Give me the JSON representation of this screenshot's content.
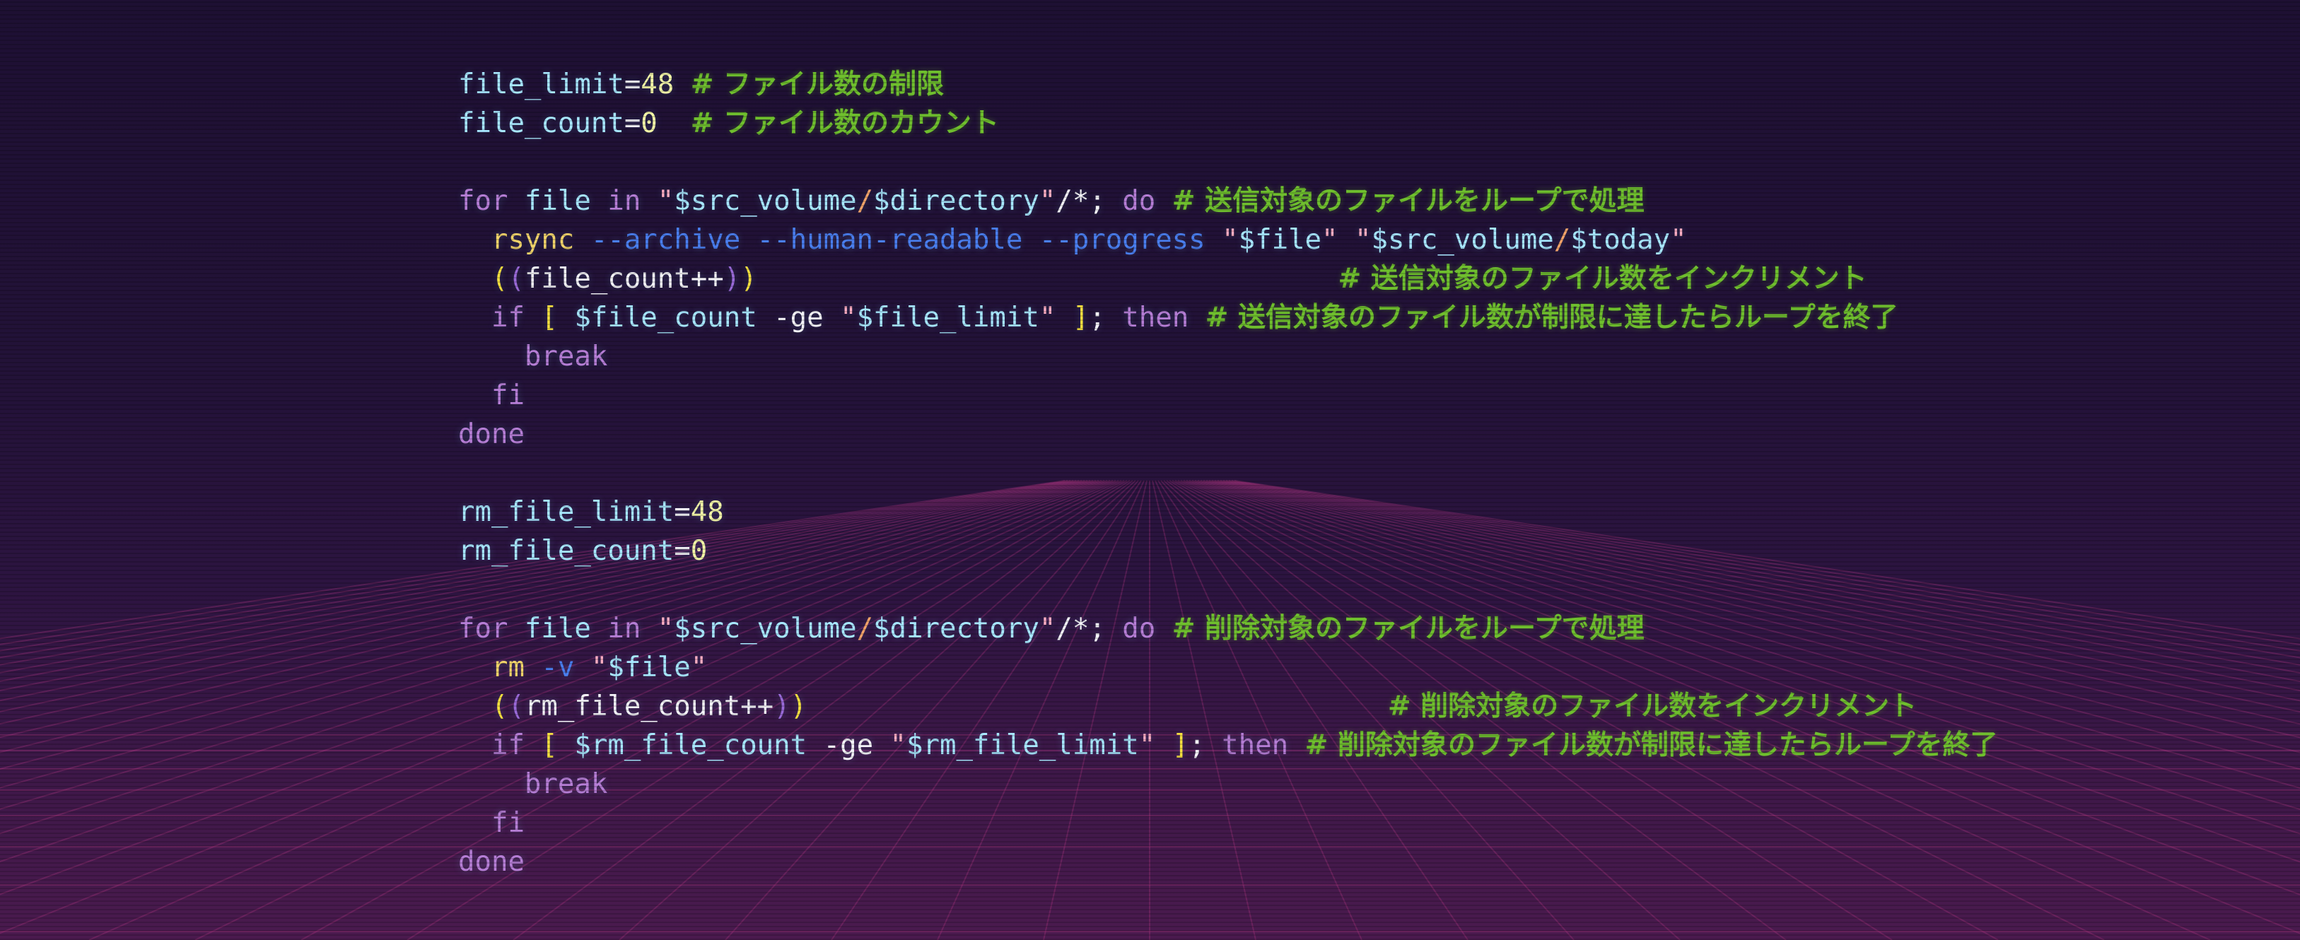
{
  "colors": {
    "variable": "#a8e8ff",
    "operator": "#f4f4f8",
    "number": "#f4f8a8",
    "comment": "#6fbf2e",
    "keyword": "#b67ed6",
    "string_quote": "#ffb0c4",
    "path_separator": "#f3a46a",
    "command": "#f1d46a",
    "flag": "#4a7ff0",
    "paren_outer": "#f5e040",
    "paren_inner": "#9a6ad8",
    "background_top": "#1e1033",
    "background_bottom": "#4a1a4e",
    "grid_line": "#c03a8a"
  },
  "code": {
    "lines": [
      [
        {
          "t": "file_limit",
          "c": "var"
        },
        {
          "t": "=",
          "c": "op"
        },
        {
          "t": "48",
          "c": "num"
        },
        {
          "t": " ",
          "c": "plain"
        },
        {
          "t": "# ファイル数の制限",
          "c": "com"
        }
      ],
      [
        {
          "t": "file_count",
          "c": "var"
        },
        {
          "t": "=",
          "c": "op"
        },
        {
          "t": "0",
          "c": "num"
        },
        {
          "t": "  ",
          "c": "plain"
        },
        {
          "t": "# ファイル数のカウント",
          "c": "com"
        }
      ],
      [],
      [
        {
          "t": "for",
          "c": "kw"
        },
        {
          "t": " file ",
          "c": "var"
        },
        {
          "t": "in",
          "c": "kw"
        },
        {
          "t": " ",
          "c": "plain"
        },
        {
          "t": "\"",
          "c": "str"
        },
        {
          "t": "$src_volume",
          "c": "var"
        },
        {
          "t": "/",
          "c": "sep"
        },
        {
          "t": "$directory",
          "c": "var"
        },
        {
          "t": "\"",
          "c": "str"
        },
        {
          "t": "/*; ",
          "c": "plain"
        },
        {
          "t": "do",
          "c": "kw"
        },
        {
          "t": " ",
          "c": "plain"
        },
        {
          "t": "# 送信対象のファイルをループで処理",
          "c": "com"
        }
      ],
      [
        {
          "t": "  ",
          "c": "plain"
        },
        {
          "t": "rsync",
          "c": "cmd"
        },
        {
          "t": " ",
          "c": "plain"
        },
        {
          "t": "--archive",
          "c": "flag"
        },
        {
          "t": " ",
          "c": "plain"
        },
        {
          "t": "--human-readable",
          "c": "flag"
        },
        {
          "t": " ",
          "c": "plain"
        },
        {
          "t": "--progress",
          "c": "flag"
        },
        {
          "t": " ",
          "c": "plain"
        },
        {
          "t": "\"",
          "c": "str"
        },
        {
          "t": "$file",
          "c": "var"
        },
        {
          "t": "\"",
          "c": "str"
        },
        {
          "t": " ",
          "c": "plain"
        },
        {
          "t": "\"",
          "c": "str"
        },
        {
          "t": "$src_volume",
          "c": "var"
        },
        {
          "t": "/",
          "c": "sep"
        },
        {
          "t": "$today",
          "c": "var"
        },
        {
          "t": "\"",
          "c": "str"
        }
      ],
      [
        {
          "t": "  ",
          "c": "plain"
        },
        {
          "t": "(",
          "c": "paren"
        },
        {
          "t": "(",
          "c": "paren2"
        },
        {
          "t": "file_count++",
          "c": "plain"
        },
        {
          "t": ")",
          "c": "paren2"
        },
        {
          "t": ")",
          "c": "paren"
        },
        {
          "t": "                                   ",
          "c": "plain"
        },
        {
          "t": "# 送信対象のファイル数をインクリメント",
          "c": "com"
        }
      ],
      [
        {
          "t": "  ",
          "c": "plain"
        },
        {
          "t": "if",
          "c": "kw"
        },
        {
          "t": " ",
          "c": "plain"
        },
        {
          "t": "[",
          "c": "paren"
        },
        {
          "t": " ",
          "c": "plain"
        },
        {
          "t": "$file_count",
          "c": "var"
        },
        {
          "t": " -ge ",
          "c": "plain"
        },
        {
          "t": "\"",
          "c": "str"
        },
        {
          "t": "$file_limit",
          "c": "var"
        },
        {
          "t": "\"",
          "c": "str"
        },
        {
          "t": " ",
          "c": "plain"
        },
        {
          "t": "]",
          "c": "paren"
        },
        {
          "t": "; ",
          "c": "plain"
        },
        {
          "t": "then",
          "c": "kw"
        },
        {
          "t": " ",
          "c": "plain"
        },
        {
          "t": "# 送信対象のファイル数が制限に達したらループを終了",
          "c": "com"
        }
      ],
      [
        {
          "t": "    ",
          "c": "plain"
        },
        {
          "t": "break",
          "c": "kw"
        }
      ],
      [
        {
          "t": "  ",
          "c": "plain"
        },
        {
          "t": "fi",
          "c": "kw"
        }
      ],
      [
        {
          "t": "done",
          "c": "kw"
        }
      ],
      [],
      [
        {
          "t": "rm_file_limit",
          "c": "var"
        },
        {
          "t": "=",
          "c": "op"
        },
        {
          "t": "48",
          "c": "num"
        }
      ],
      [
        {
          "t": "rm_file_count",
          "c": "var"
        },
        {
          "t": "=",
          "c": "op"
        },
        {
          "t": "0",
          "c": "num"
        }
      ],
      [],
      [
        {
          "t": "for",
          "c": "kw"
        },
        {
          "t": " file ",
          "c": "var"
        },
        {
          "t": "in",
          "c": "kw"
        },
        {
          "t": " ",
          "c": "plain"
        },
        {
          "t": "\"",
          "c": "str"
        },
        {
          "t": "$src_volume",
          "c": "var"
        },
        {
          "t": "/",
          "c": "sep"
        },
        {
          "t": "$directory",
          "c": "var"
        },
        {
          "t": "\"",
          "c": "str"
        },
        {
          "t": "/*; ",
          "c": "plain"
        },
        {
          "t": "do",
          "c": "kw"
        },
        {
          "t": " ",
          "c": "plain"
        },
        {
          "t": "# 削除対象のファイルをループで処理",
          "c": "com"
        }
      ],
      [
        {
          "t": "  ",
          "c": "plain"
        },
        {
          "t": "rm",
          "c": "cmd"
        },
        {
          "t": " ",
          "c": "plain"
        },
        {
          "t": "-v",
          "c": "flag"
        },
        {
          "t": " ",
          "c": "plain"
        },
        {
          "t": "\"",
          "c": "str"
        },
        {
          "t": "$file",
          "c": "var"
        },
        {
          "t": "\"",
          "c": "str"
        }
      ],
      [
        {
          "t": "  ",
          "c": "plain"
        },
        {
          "t": "(",
          "c": "paren"
        },
        {
          "t": "(",
          "c": "paren2"
        },
        {
          "t": "rm_file_count++",
          "c": "plain"
        },
        {
          "t": ")",
          "c": "paren2"
        },
        {
          "t": ")",
          "c": "paren"
        },
        {
          "t": "                                   ",
          "c": "plain"
        },
        {
          "t": "# 削除対象のファイル数をインクリメント",
          "c": "com"
        }
      ],
      [
        {
          "t": "  ",
          "c": "plain"
        },
        {
          "t": "if",
          "c": "kw"
        },
        {
          "t": " ",
          "c": "plain"
        },
        {
          "t": "[",
          "c": "paren"
        },
        {
          "t": " ",
          "c": "plain"
        },
        {
          "t": "$rm_file_count",
          "c": "var"
        },
        {
          "t": " -ge ",
          "c": "plain"
        },
        {
          "t": "\"",
          "c": "str"
        },
        {
          "t": "$rm_file_limit",
          "c": "var"
        },
        {
          "t": "\"",
          "c": "str"
        },
        {
          "t": " ",
          "c": "plain"
        },
        {
          "t": "]",
          "c": "paren"
        },
        {
          "t": "; ",
          "c": "plain"
        },
        {
          "t": "then",
          "c": "kw"
        },
        {
          "t": " ",
          "c": "plain"
        },
        {
          "t": "# 削除対象のファイル数が制限に達したらループを終了",
          "c": "com"
        }
      ],
      [
        {
          "t": "    ",
          "c": "plain"
        },
        {
          "t": "break",
          "c": "kw"
        }
      ],
      [
        {
          "t": "  ",
          "c": "plain"
        },
        {
          "t": "fi",
          "c": "kw"
        }
      ],
      [
        {
          "t": "done",
          "c": "kw"
        }
      ]
    ]
  }
}
